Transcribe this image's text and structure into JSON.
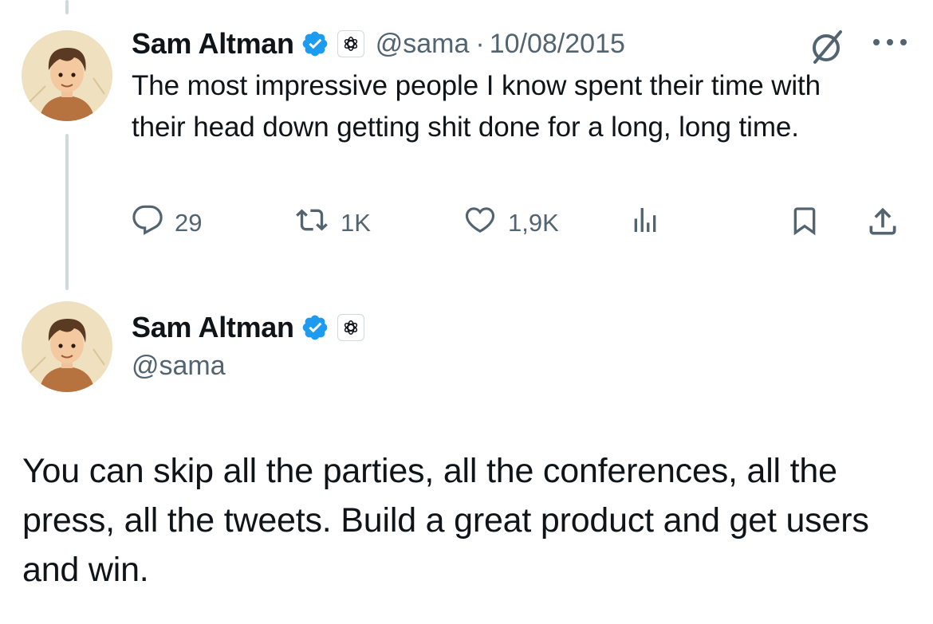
{
  "parent_tweet": {
    "author": {
      "name": "Sam Altman",
      "handle": "@sama",
      "verified_icon": "verified-badge-icon",
      "affiliation_icon": "openai-logo-icon"
    },
    "separator": "·",
    "date": "10/08/2015",
    "text": "The most impressive people I know spent their time with their head down getting shit done for a long, long time.",
    "top_icons": [
      "grok-icon",
      "more-icon"
    ],
    "actions": {
      "replies": "29",
      "reposts": "1K",
      "likes": "1,9K",
      "views_icon": "views-icon",
      "bookmark_icon": "bookmark-icon",
      "share_icon": "share-icon"
    }
  },
  "main_tweet": {
    "author": {
      "name": "Sam Altman",
      "handle": "@sama",
      "verified_icon": "verified-badge-icon",
      "affiliation_icon": "openai-logo-icon"
    },
    "text": "You can skip all the parties, all the conferences, all the press, all the tweets.  Build a great product and get users and win."
  },
  "colors": {
    "verified_blue": "#1d9bf0",
    "text_primary": "#0f1419",
    "text_secondary": "#536471",
    "thread_line": "#cfd9de"
  }
}
